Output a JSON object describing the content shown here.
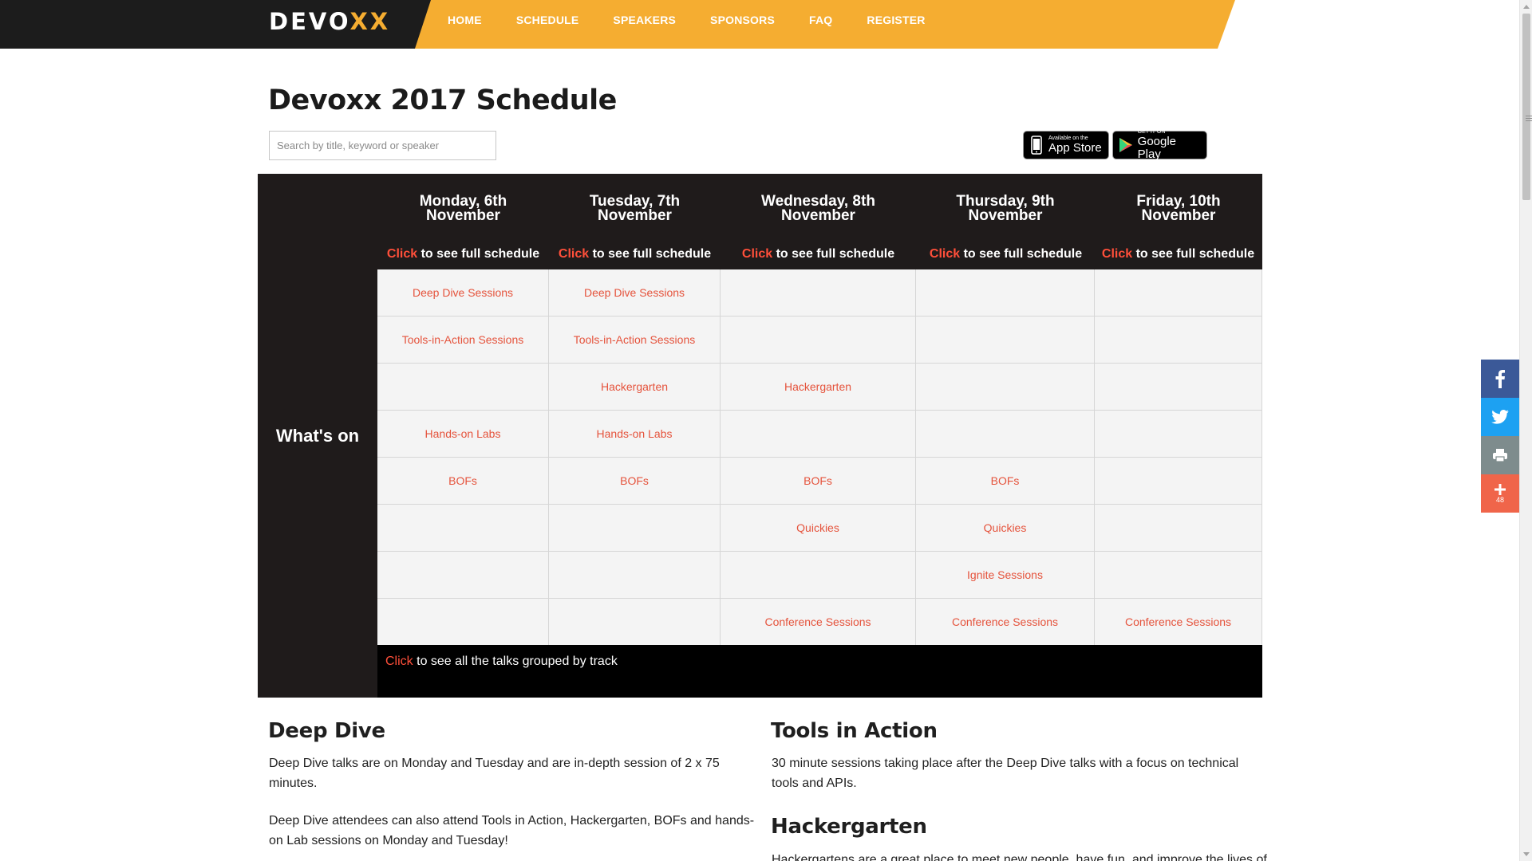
{
  "header": {
    "logo_main": "DEVO",
    "logo_accent": "XX",
    "nav": [
      "HOME",
      "SCHEDULE",
      "SPEAKERS",
      "SPONSORS",
      "FAQ",
      "REGISTER"
    ]
  },
  "page": {
    "title": "Devoxx 2017 Schedule",
    "search_placeholder": "Search by title, keyword or speaker"
  },
  "store_badges": {
    "appstore_small": "Available on the",
    "appstore_big": "App Store",
    "googleplay_small": "GET IT ON",
    "googleplay_big": "Google Play"
  },
  "schedule": {
    "row_header": "What's on",
    "click_word": "Click",
    "day_link_suffix": " to see full schedule",
    "days": [
      {
        "line1": "Monday, 6th",
        "line2": "November"
      },
      {
        "line1": "Tuesday, 7th",
        "line2": "November"
      },
      {
        "line1": "Wednesday, 8th",
        "line2": "November"
      },
      {
        "line1": "Thursday, 9th",
        "line2": "November"
      },
      {
        "line1": "Friday, 10th",
        "line2": "November"
      }
    ],
    "rows": [
      [
        "Deep Dive Sessions",
        "Deep Dive Sessions",
        "",
        "",
        ""
      ],
      [
        "Tools-in-Action Sessions",
        "Tools-in-Action Sessions",
        "",
        "",
        ""
      ],
      [
        "",
        "Hackergarten",
        "Hackergarten",
        "",
        ""
      ],
      [
        "Hands-on Labs",
        "Hands-on Labs",
        "",
        "",
        ""
      ],
      [
        "BOFs",
        "BOFs",
        "BOFs",
        "BOFs",
        ""
      ],
      [
        "",
        "",
        "Quickies",
        "Quickies",
        ""
      ],
      [
        "",
        "",
        "",
        "Ignite Sessions",
        ""
      ],
      [
        "",
        "",
        "Conference Sessions",
        "Conference Sessions",
        "Conference Sessions"
      ]
    ],
    "track_link_suffix": " to see all the talks grouped by track"
  },
  "sections": {
    "deep_dive_title": "Deep Dive",
    "deep_dive_p1_l1": "Deep Dive talks are on Monday and Tuesday and are in-depth session of 2 x 75",
    "deep_dive_p1_l2": "minutes.",
    "deep_dive_p2_l1": "Deep Dive attendees can also attend Tools in Action, Hackergarten, BOFs and hands-",
    "deep_dive_p2_l2": "on Lab sessions on Monday and Tuesday!",
    "tools_title": "Tools in Action",
    "tools_l1": "30 minute sessions taking place after the Deep Dive talks with a focus on technical",
    "tools_l2": "tools and APIs.",
    "hacker_title": "Hackergarten",
    "hacker_l1": "Hackergartens are a great place to meet new people, have fun, and improve the lives of"
  },
  "share": {
    "count": "48"
  },
  "colors": {
    "accent_orange": "#f5ad31",
    "link_red": "#e5533c",
    "dark": "#1f1b1b",
    "facebook": "#3b5998",
    "twitter": "#1da1f2",
    "print": "#7e8c8d",
    "more": "#f0654a"
  },
  "icons": [
    "apple-icon",
    "google-play-icon",
    "facebook-icon",
    "twitter-icon",
    "print-icon",
    "plus-icon"
  ]
}
